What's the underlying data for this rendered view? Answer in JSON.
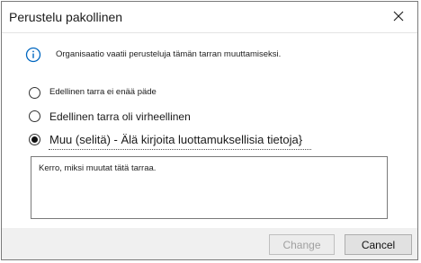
{
  "dialog": {
    "title": "Perustelu pakollinen",
    "info_text": "Organisaatio vaatii perusteluja tämän tarran muuttamiseksi.",
    "options": [
      {
        "label": "Edellinen tarra ei enää päde",
        "selected": false
      },
      {
        "label": "Edellinen tarra oli virheellinen",
        "selected": false
      },
      {
        "label": "Muu (selitä) - Älä kirjoita luottamuksellisia tietoja}",
        "selected": true
      }
    ],
    "reason_placeholder": "Kerro, miksi muutat tätä tarraa.",
    "reason_value": "",
    "buttons": {
      "change_label": "Change",
      "change_enabled": false,
      "cancel_label": "Cancel"
    }
  },
  "icons": {
    "close": "close-icon",
    "info": "info-icon"
  },
  "colors": {
    "info_blue": "#0067c0",
    "disabled_text": "#a0a0a0",
    "button_face": "#e1e1e1"
  }
}
